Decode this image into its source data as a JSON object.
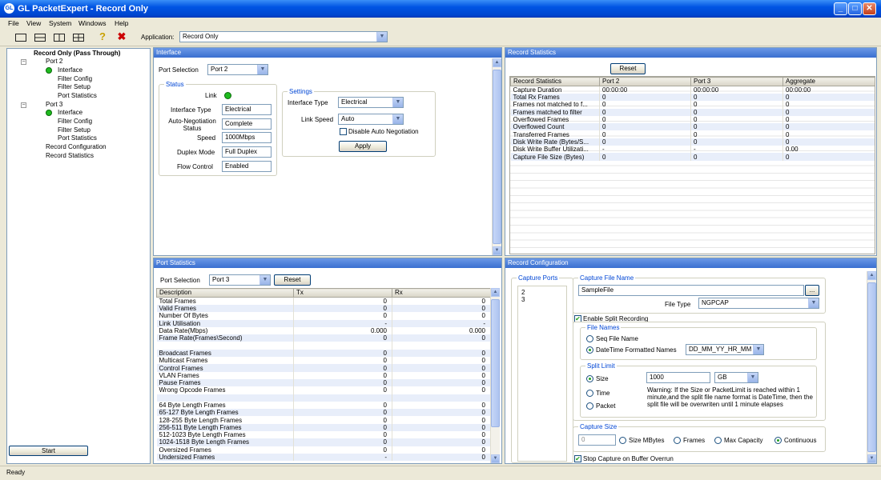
{
  "window": {
    "title": "GL PacketExpert - Record Only",
    "icon_text": "GL"
  },
  "menu": [
    "File",
    "View",
    "System",
    "Windows",
    "Help"
  ],
  "toolbar": {
    "application_label": "Application:",
    "application_value": "Record Only"
  },
  "tree": {
    "root": "Record Only (Pass Through)",
    "port2": {
      "label": "Port 2",
      "items": [
        "Interface",
        "Filter Config",
        "Filter Setup",
        "Port Statistics"
      ]
    },
    "port3": {
      "label": "Port 3",
      "items": [
        "Interface",
        "Filter Config",
        "Filter Setup",
        "Port Statistics"
      ]
    },
    "record_configuration": "Record Configuration",
    "record_statistics": "Record Statistics"
  },
  "start_button": "Start",
  "interface": {
    "title": "Interface",
    "port_selection_label": "Port Selection",
    "port_selection_value": "Port 2",
    "status": {
      "title": "Status",
      "link_label": "Link",
      "interface_type_label": "Interface Type",
      "interface_type_value": "Electrical",
      "autoneg_label": "Auto-Negotiation Status",
      "autoneg_value": "Complete",
      "speed_label": "Speed",
      "speed_value": "1000Mbps",
      "duplex_label": "Duplex Mode",
      "duplex_value": "Full Duplex",
      "flow_label": "Flow Control",
      "flow_value": "Enabled"
    },
    "settings": {
      "title": "Settings",
      "interface_type_label": "Interface Type",
      "interface_type_value": "Electrical",
      "link_speed_label": "Link Speed",
      "link_speed_value": "Auto",
      "disable_autoneg_label": "Disable Auto Negotiation",
      "apply": "Apply"
    }
  },
  "record_statistics": {
    "title": "Record Statistics",
    "reset": "Reset",
    "columns": [
      "Record Statistics",
      "Port 2",
      "Port 3",
      "Aggregate"
    ],
    "rows": [
      [
        "Capture Duration",
        "00:00:00",
        "00:00:00",
        "00:00:00"
      ],
      [
        "Total Rx Frames",
        "0",
        "0",
        "0"
      ],
      [
        "Frames not matched to f...",
        "0",
        "0",
        "0"
      ],
      [
        "Frames matched to filter",
        "0",
        "0",
        "0"
      ],
      [
        "Overflowed Frames",
        "0",
        "0",
        "0"
      ],
      [
        "Overflowed Count",
        "0",
        "0",
        "0"
      ],
      [
        "Transferred Frames",
        "0",
        "0",
        "0"
      ],
      [
        "Disk Write Rate (Bytes/S...",
        "0",
        "0",
        "0"
      ],
      [
        "Disk Write Buffer Utilizati...",
        "-",
        "-",
        "0.00"
      ],
      [
        "Capture File Size (Bytes)",
        "0",
        "0",
        "0"
      ]
    ]
  },
  "port_statistics": {
    "title": "Port Statistics",
    "port_selection_label": "Port Selection",
    "port_selection_value": "Port 3",
    "reset": "Reset",
    "columns": [
      "Description",
      "Tx",
      "Rx"
    ],
    "rows": [
      [
        "Total Frames",
        "0",
        "0"
      ],
      [
        "Valid Frames",
        "0",
        "0"
      ],
      [
        "Number Of Bytes",
        "0",
        "0"
      ],
      [
        "Link Utilisation",
        "-",
        "-"
      ],
      [
        "Data Rate(Mbps)",
        "0.000",
        "0.000"
      ],
      [
        "Frame Rate(Frames\\Second)",
        "0",
        "0"
      ],
      [
        "",
        "",
        ""
      ],
      [
        "Broadcast Frames",
        "0",
        "0"
      ],
      [
        "Multicast Frames",
        "0",
        "0"
      ],
      [
        "Control Frames",
        "0",
        "0"
      ],
      [
        "VLAN Frames",
        "0",
        "0"
      ],
      [
        "Pause Frames",
        "0",
        "0"
      ],
      [
        "Wrong Opcode Frames",
        "0",
        "0"
      ],
      [
        "",
        "",
        ""
      ],
      [
        "64 Byte Length Frames",
        "0",
        "0"
      ],
      [
        "65-127 Byte Length Frames",
        "0",
        "0"
      ],
      [
        "128-255 Byte Length Frames",
        "0",
        "0"
      ],
      [
        "256-511 Byte Length Frames",
        "0",
        "0"
      ],
      [
        "512-1023 Byte Length Frames",
        "0",
        "0"
      ],
      [
        "1024-1518 Byte Length Frames",
        "0",
        "0"
      ],
      [
        "Oversized Frames",
        "0",
        "0"
      ],
      [
        "Undersized Frames",
        "-",
        "0"
      ]
    ]
  },
  "record_configuration": {
    "title": "Record Configuration",
    "capture_ports_label": "Capture Ports",
    "capture_ports": [
      "2",
      "3"
    ],
    "capture_file_name_label": "Capture File Name",
    "capture_file_name_value": "SampleFile",
    "browse": "...",
    "file_type_label": "File Type",
    "file_type_value": "NGPCAP",
    "enable_split_label": "Enable Split Recording",
    "file_names_label": "File Names",
    "seq_file_name": "Seq File Name",
    "datetime_names": "DateTime Formatted Names",
    "datetime_format": "DD_MM_YY_HR_MM",
    "split_limit_label": "Split Limit",
    "size_label": "Size",
    "size_value": "1000",
    "size_unit": "GB",
    "time_label": "Time",
    "packet_label": "Packet",
    "warning": "Warning: If the Size or PacketLimit is reached within 1 minute,and the split file name format is DateTime, then the split file will be overwriten until 1 minute elapses",
    "capture_size_label": "Capture Size",
    "capture_size_value": "0",
    "size_mbytes": "Size MBytes",
    "frames": "Frames",
    "max_capacity": "Max Capacity",
    "continuous": "Continuous",
    "stop_capture_label": "Stop Capture on Buffer Overrun"
  },
  "status": "Ready"
}
